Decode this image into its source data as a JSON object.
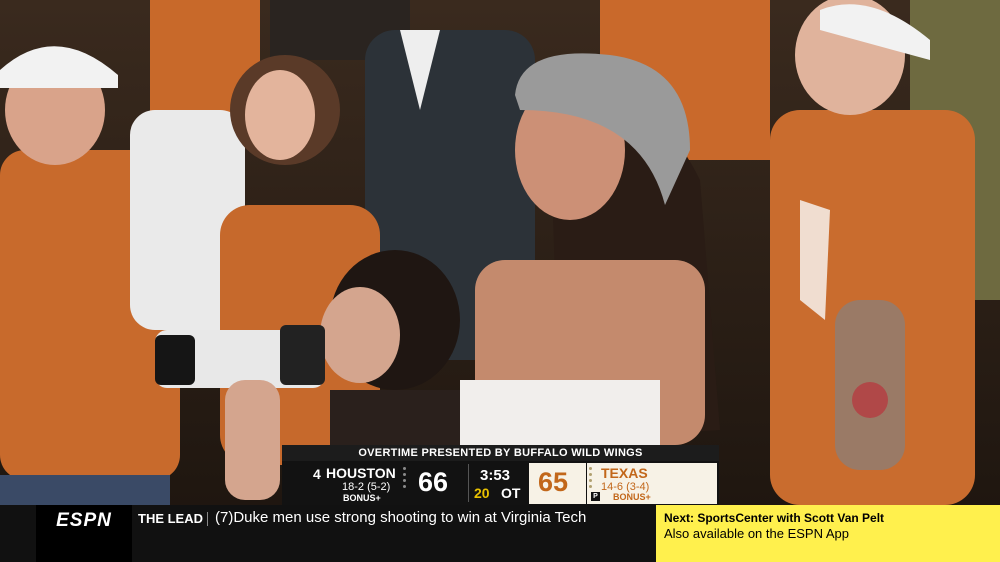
{
  "scorebug": {
    "header": "OVERTIME PRESENTED BY BUFFALO WILD WINGS",
    "away": {
      "rank": "4",
      "name": "HOUSTON",
      "record": "18-2 (5-2)",
      "bonus": "BONUS+",
      "score": "66"
    },
    "home": {
      "name": "TEXAS",
      "record": "14-6 (3-4)",
      "bonus": "BONUS+",
      "score": "65",
      "possession": "P"
    },
    "clock": "3:53",
    "shot_clock": "20",
    "period": "OT"
  },
  "ticker": {
    "logo": "ESPN",
    "section": "THE LEAD",
    "headline": "(7)Duke men use strong shooting to win at Virginia Tech",
    "next_title": "Next: SportsCenter with Scott Van Pelt",
    "next_subtitle": "Also available on the ESPN App"
  },
  "colors": {
    "texas_orange": "#c2671a",
    "ticker_yellow": "#fff04d",
    "shot_clock_yellow": "#e8c100"
  }
}
